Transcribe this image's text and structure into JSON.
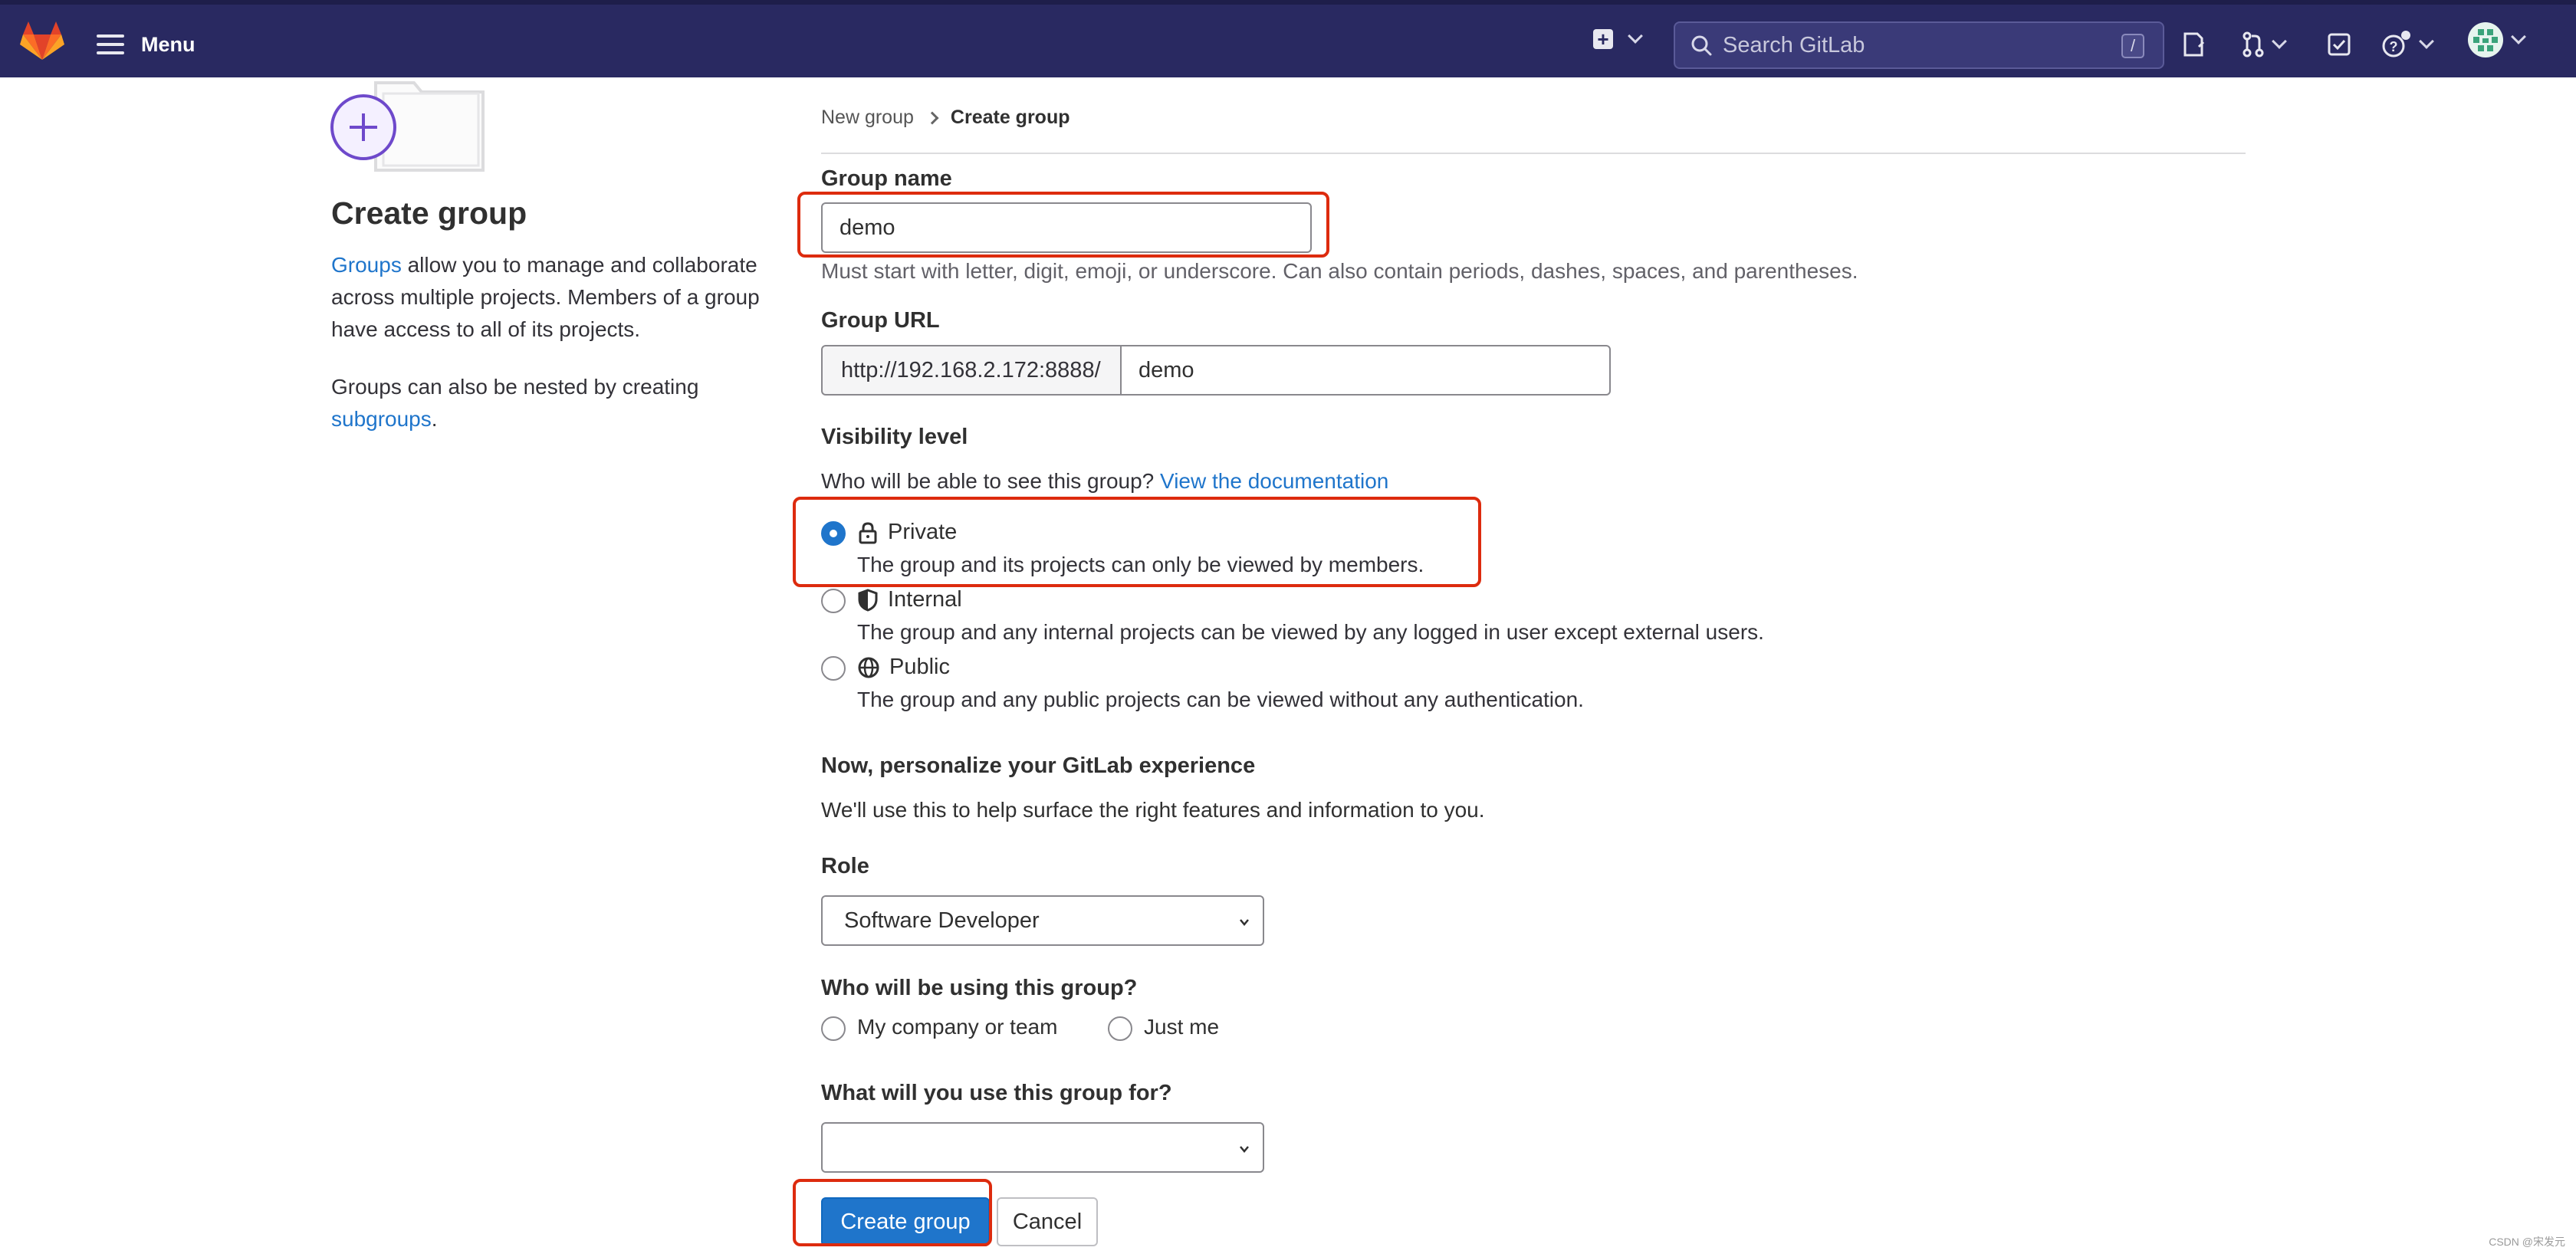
{
  "topbar": {
    "menu_label": "Menu",
    "search_placeholder": "Search GitLab",
    "search_shortcut": "/"
  },
  "sidebar": {
    "title": "Create group",
    "intro_link": "Groups",
    "intro_text": " allow you to manage and collaborate across multiple projects. Members of a group have access to all of its projects.",
    "nested_text": "Groups can also be nested by creating ",
    "nested_link": "subgroups",
    "nested_end": "."
  },
  "breadcrumb": {
    "parent": "New group",
    "current": "Create group"
  },
  "form": {
    "group_name": {
      "label": "Group name",
      "value": "demo",
      "help": "Must start with letter, digit, emoji, or underscore. Can also contain periods, dashes, spaces, and parentheses."
    },
    "group_url": {
      "label": "Group URL",
      "prefix": "http://192.168.2.172:8888/",
      "value": "demo"
    },
    "visibility": {
      "label": "Visibility level",
      "question": "Who will be able to see this group? ",
      "doc_link": "View the documentation",
      "selected": "Private",
      "options": [
        {
          "label": "Private",
          "icon": "lock-icon",
          "description": "The group and its projects can only be viewed by members."
        },
        {
          "label": "Internal",
          "icon": "shield-icon",
          "description": "The group and any internal projects can be viewed by any logged in user except external users."
        },
        {
          "label": "Public",
          "icon": "globe-icon",
          "description": "The group and any public projects can be viewed without any authentication."
        }
      ]
    },
    "personalize": {
      "heading": "Now, personalize your GitLab experience",
      "subtext": "We'll use this to help surface the right features and information to you."
    },
    "role": {
      "label": "Role",
      "value": "Software Developer"
    },
    "audience": {
      "label": "Who will be using this group?",
      "options": [
        "My company or team",
        "Just me"
      ]
    },
    "purpose": {
      "label": "What will you use this group for?",
      "value": ""
    },
    "submit_label": "Create group",
    "cancel_label": "Cancel"
  },
  "watermark": "CSDN @宋发元",
  "colors": {
    "topbar": "#292961",
    "link": "#1f75cb",
    "primary_button": "#1f75cb",
    "highlight_box": "#dd2b0e"
  }
}
